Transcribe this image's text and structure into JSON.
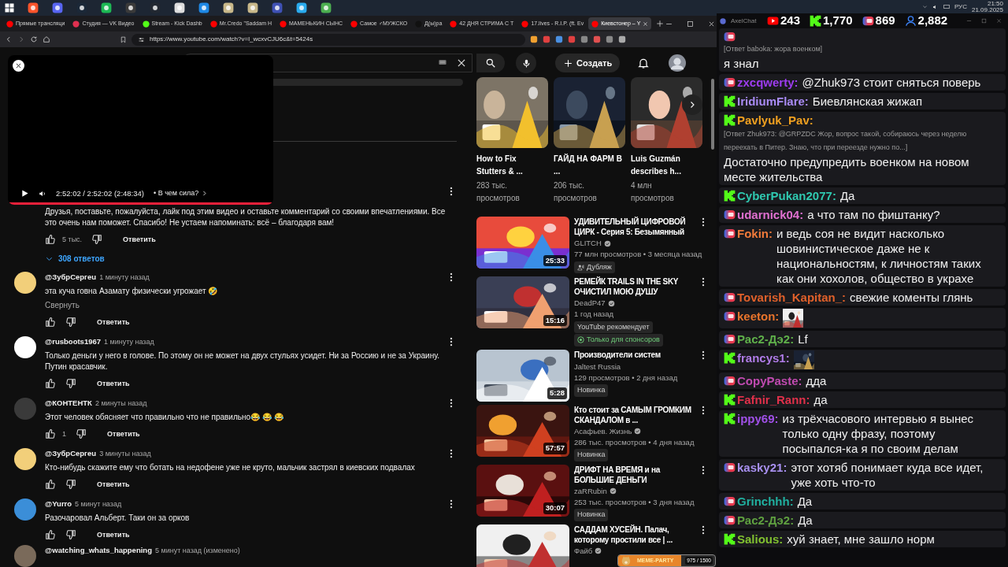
{
  "tray": {
    "language": "РУС",
    "time": "21:50",
    "date": "21.09.2025"
  },
  "browser": {
    "tabs": [
      {
        "title": "Прямые трансляци",
        "kind": "youtube",
        "selected": false
      },
      {
        "title": "Студия — VK Видео",
        "kind": "vk",
        "selected": false
      },
      {
        "title": "Stream - Kick Dashb",
        "kind": "kick",
        "selected": false
      },
      {
        "title": "Mr.Credo \"Saddam H",
        "kind": "youtube",
        "selected": false
      },
      {
        "title": "МАМЕНЬКИН СЫНС",
        "kind": "youtube",
        "selected": false
      },
      {
        "title": "Самое ♂МУЖСКО",
        "kind": "youtube",
        "selected": false
      },
      {
        "title": "Д(ы)ра",
        "kind": "tiktok",
        "selected": false
      },
      {
        "title": "42 ДНЯ СТРИМА С Т",
        "kind": "youtube",
        "selected": false
      },
      {
        "title": "17.lives - R.I.P. (ft. Ev",
        "kind": "youtube",
        "selected": false
      },
      {
        "title": "Киевстонер – Y",
        "kind": "youtube",
        "selected": true
      }
    ],
    "url": "https://www.youtube.com/watch?v=l_wcxvCJU6c&t=5424s"
  },
  "youtube": {
    "create_label": "Создать",
    "mini_player": {
      "time": "2:52:02 / 2:52:02 (2:48:34)",
      "chapter": "• В чем сила?",
      "level": 1
    },
    "pinned_comment": {
      "text": "Друзья, поставьте, пожалуйста, лайк под этим видео и оставьте комментарий со своими впечатлениями. Все это очень нам поможет. Спасибо! Не устаем напоминать: всё – благодаря вам!",
      "likes": "5 тыс.",
      "reply_label": "Ответить",
      "replies_toggle": "308 ответов"
    },
    "replies": [
      {
        "author": "@ЗубрСергеu",
        "time": "1 минуту назад",
        "text": "эта куча говна Азамату физически угрожает 🤣",
        "collapse": "Свернуть",
        "reply_label": "Ответить"
      },
      {
        "author": "@rusboots1967",
        "time": "1 минуту назад",
        "text": "Только деньги у него в голове. По этому он не может на двух стульях усидет. Ни за Россию и не за Украину. Путин красавчик.",
        "reply_label": "Ответить"
      },
      {
        "author": "@КОНТЕНТК",
        "time": "2 минуты назад",
        "text": "Этот человек обясняет что правильно что не правильно😂 😂 😂",
        "likes": "1",
        "reply_label": "Ответить"
      },
      {
        "author": "@ЗубрСергеu",
        "time": "3 минуты назад",
        "text": "Кто-нибудь скажите ему что ботать  на недофене уже не круто, мальчик застрял в киевских подвалах",
        "reply_label": "Ответить"
      },
      {
        "author": "@Yurro",
        "time": "5 минут назад",
        "text": "Разочаровал Альберт. Таки он за орков",
        "reply_label": "Ответить"
      }
    ],
    "partial_reply": {
      "author": "@watching_whats_happening",
      "time": "5 минут назад (изменено)"
    }
  },
  "sidebar": {
    "shelf": [
      {
        "title": "How to Fix Stutters & ...",
        "views": "283 тыс. просмотров"
      },
      {
        "title": "ГАЙД НА ФАРМ В ...",
        "views": "206 тыс. просмотров"
      },
      {
        "title": "Luis Guzmán describes h...",
        "views": "4 млн просмотров"
      }
    ],
    "videos": [
      {
        "title": "УДИВИТЕЛЬНЫЙ ЦИФРОВОЙ ЦИРК - Серия 5: Безымянный",
        "channel": "GLITCH",
        "verified": true,
        "meta": "77 млн просмотров • 3 месяца назад",
        "duration": "25:33",
        "badges": [
          {
            "kind": "dub",
            "label": "Дубляж"
          }
        ]
      },
      {
        "title": "РЕМЕЙК TRAILS IN THE SKY ОЧИСТИЛ МОЮ ДУШУ",
        "channel": "DeadP47",
        "verified": true,
        "meta": "1 год назад",
        "duration": "15:16",
        "badges": [
          {
            "kind": "plain",
            "label": "YouTube рекомендует"
          },
          {
            "kind": "members",
            "label": "Только для спонсоров"
          }
        ]
      },
      {
        "title": "Производители систем",
        "channel": "Jaltest Russia",
        "verified": false,
        "meta": "129 просмотров • 2 дня назад",
        "duration": "5:28",
        "badges": [
          {
            "kind": "plain",
            "label": "Новинка"
          }
        ]
      },
      {
        "title": "Кто стоит за САМЫМ ГРОМКИМ СКАНДАЛОМ в ...",
        "channel": "Асафьев. Жизнь",
        "verified": true,
        "meta": "286 тыс. просмотров • 4 дня назад",
        "duration": "57:57",
        "badges": [
          {
            "kind": "plain",
            "label": "Новинка"
          }
        ]
      },
      {
        "title": "ДРИФТ НА ВРЕМЯ и на БОЛЬШИЕ ДЕНЬГИ",
        "channel": "zaRRubin",
        "verified": true,
        "meta": "253 тыс. просмотров • 3 дня назад",
        "duration": "30:07",
        "badges": [
          {
            "kind": "plain",
            "label": "Новинка"
          }
        ]
      },
      {
        "title": "САДДАМ ХУСЕЙН. Палач, которому простили все | ...",
        "channel": "Файб",
        "verified": true
      }
    ]
  },
  "meme_widget": {
    "label": "MEME-PARTY",
    "progress": "975 / 1500",
    "level": 0.65
  },
  "chat": {
    "app_title": "AxelChat",
    "counters": [
      {
        "kind": "youtube",
        "value": "243"
      },
      {
        "kind": "kick",
        "value": "1,770"
      },
      {
        "kind": "vk",
        "value": "869"
      },
      {
        "kind": "viewers",
        "value": "2,882"
      }
    ],
    "messages": [
      {
        "kind": "vk",
        "reply": "[Ответ baboka: жора военком]",
        "text": "я знал"
      },
      {
        "kind": "vk",
        "author": "zxcqwerty:",
        "color": "#9d3cf0",
        "text": "@Zhuk973 стоит сняться поверь"
      },
      {
        "kind": "kick",
        "author": "IridiumFlare:",
        "color": "#a98bf5",
        "text": "Биевлянская жижап"
      },
      {
        "kind": "kick",
        "author": "Pavlyuk_Pav:",
        "color": "#f0a020",
        "reply": "[Ответ Zhuk973: @GRPZDC Жор, вопрос такой, собираюсь через неделю переехать в Питер. Знаю, что при переезде нужно по...]",
        "text": "Достаточно предупредить военком на новом месте жительства"
      },
      {
        "kind": "kick",
        "author": "CyberPukan2077:",
        "color": "#2fc9b0",
        "text": "Да"
      },
      {
        "kind": "vk",
        "author": "udarnick04:",
        "color": "#e070d0",
        "text": "а что там по фиштанку?"
      },
      {
        "kind": "vk",
        "author": "Fokin:",
        "color": "#f07a3a",
        "text": "и ведь соя не видит насколько шовинистическое даже не к национальностям, к личностям таких как они хохолов, общество в украхе"
      },
      {
        "kind": "vk",
        "author": "Tovarish_Kapitan_:",
        "color": "#e0602a",
        "text": "свежие коменты глянь"
      },
      {
        "kind": "vk",
        "author": "keeton:",
        "color": "#e8742c",
        "emote": true
      },
      {
        "kind": "vk",
        "author": "Рас2-Дэ2:",
        "color": "#5fb04a",
        "text": "Lf"
      },
      {
        "kind": "kick",
        "author": "francys1:",
        "color": "#b07ce8",
        "emote": true
      },
      {
        "kind": "vk",
        "author": "CopyPaste:",
        "color": "#c04ab0",
        "text": "дда"
      },
      {
        "kind": "kick",
        "author": "Fafnir_Rann:",
        "color": "#e0304a",
        "text": "да"
      },
      {
        "kind": "kick",
        "author": "ippy69:",
        "color": "#a050e8",
        "text": "из трёхчасового интервью я вынес только одну фразу, поэтому посыпался-ка я по своим делам"
      },
      {
        "kind": "vk",
        "author": "kasky21:",
        "color": "#a890f0",
        "text": "этот хотяб понимает куда все идет, уже хоть что-то"
      },
      {
        "kind": "vk",
        "author": "Grinchhh:",
        "color": "#20b0a0",
        "text": "Да"
      },
      {
        "kind": "vk",
        "author": "Рас2-Дэ2:",
        "color": "#5fa040",
        "text": "Да"
      },
      {
        "kind": "kick",
        "author": "Salious:",
        "color": "#80c030",
        "text": "хуй знает, мне зашло норм"
      }
    ]
  }
}
